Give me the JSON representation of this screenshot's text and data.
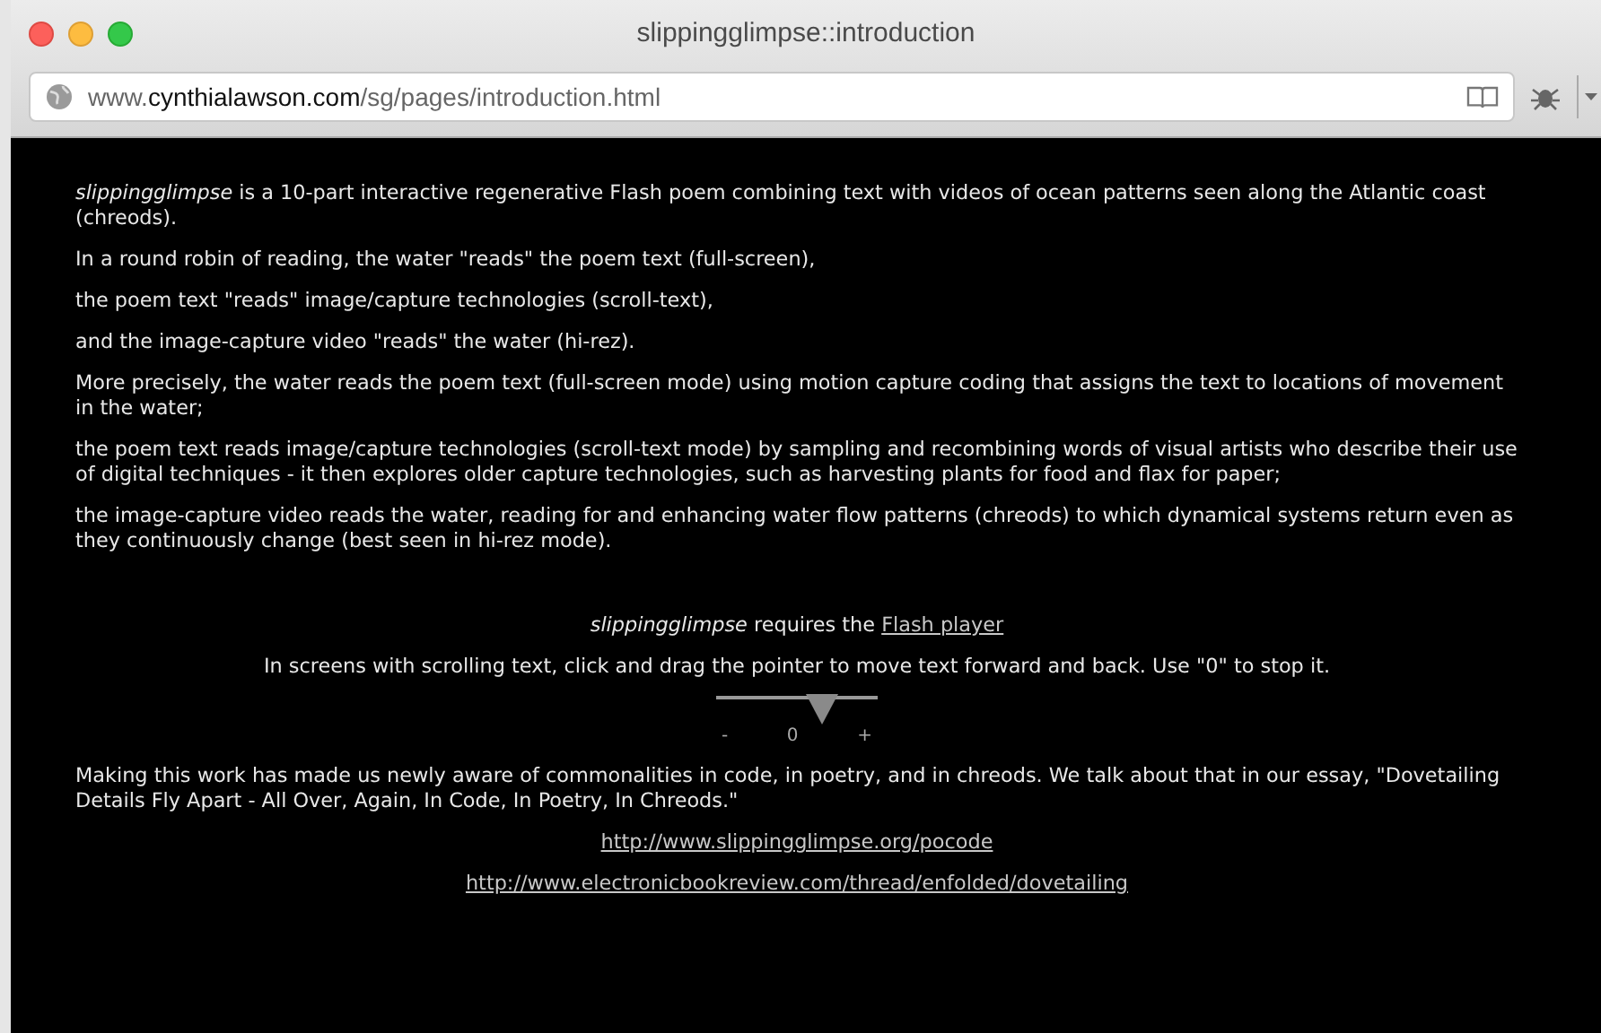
{
  "window": {
    "title": "slippingglimpse::introduction"
  },
  "address_bar": {
    "url": "www.**cynthialawson.com**/sg/pages/introduction.html"
  },
  "paragraphs": [
    "*slippingglimpse* is a 10-part interactive regenerative Flash poem combining text with videos of ocean patterns seen along the Atlantic coast (chreods).",
    "In a round robin of reading, the water \"reads\" the poem text (full-screen),",
    "the poem text \"reads\" image/capture technologies (scroll-text),",
    "and the image-capture video \"reads\" the water (hi-rez).",
    "More precisely, the water reads the poem text (full-screen mode) using motion capture coding that assigns the text to locations of movement in the water;",
    "the poem text reads image/capture technologies (scroll-text mode) by sampling and recombining words of visual artists who describe their use of digital techniques - it then explores older capture technologies, such as harvesting plants for food and flax for paper;",
    "the image-capture video reads the water, reading for and enhancing water flow patterns (chreods) to which dynamical systems return even as they continuously change (best seen in hi-rez mode)."
  ],
  "requirement": {
    "text": "*slippingglimpse* requires the",
    "link": "Flash player"
  },
  "instruction": "In screens with scrolling text, click and drag the pointer to move text forward and back. Use \"0\" to stop it.",
  "slider": {
    "level": 0.65,
    "minus": "-",
    "zero": "0",
    "plus": "+"
  },
  "essay": "Making this work has made us newly aware of commonalities in code, in poetry, and in chreods. We talk about that in our essay, \"Dovetailing Details Fly Apart - All Over, Again, In Code, In Poetry, In Chreods.\"",
  "links": [
    "http://www.slippingglimpse.org/pocode",
    "http://www.electronicbookreview.com/thread/enfolded/dovetailing"
  ]
}
